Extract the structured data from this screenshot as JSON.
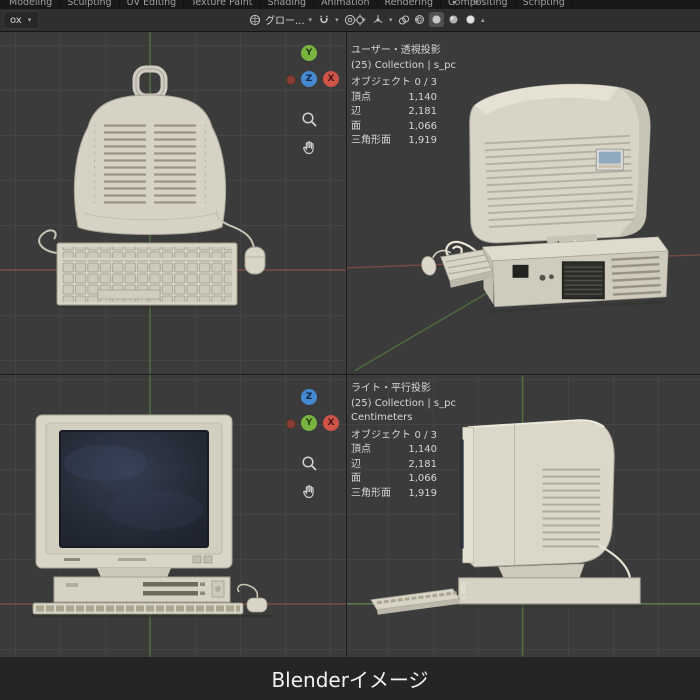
{
  "workspace_tabs": {
    "items": [
      "Modeling",
      "Sculpting",
      "UV Editing",
      "Texture Paint",
      "Shading",
      "Animation",
      "Rendering",
      "Compositing",
      "Scripting"
    ],
    "caret": "▾",
    "add_button": "+"
  },
  "toolbar": {
    "left_dropdown_value": "ox",
    "orientation_label": "グロー...",
    "caret": "▾",
    "caret_up": "▴"
  },
  "icons": {
    "transform_orientation": "globe-icon",
    "snap": "magnet-icon",
    "proportional_editing": "concentric-circles-icon",
    "cursor_tool": "3d-cursor-icon",
    "show_overlays": "overlay-spheres-icon",
    "shading_modes": [
      "wireframe-sphere",
      "solid-sphere",
      "material-sphere",
      "rendered-sphere"
    ],
    "viewport_zoom": "magnifier-icon",
    "viewport_pan": "hand-icon"
  },
  "viewports": {
    "top_left": {
      "gizmo": {
        "top_axis": "Y",
        "center_axis": "Z",
        "right_axis": "X"
      }
    },
    "top_right": {
      "view_label": "ユーザー・透視投影",
      "collection_path": "(25) Collection | s_pc",
      "stats": {
        "objects_label": "オブジェクト",
        "objects_value": "0 / 3",
        "rows": [
          {
            "label": "頂点",
            "value": "1,140"
          },
          {
            "label": "辺",
            "value": "2,181"
          },
          {
            "label": "面",
            "value": "1,066"
          },
          {
            "label": "三角形面",
            "value": "1,919"
          }
        ]
      }
    },
    "bottom_left": {
      "gizmo": {
        "top_axis": "Z",
        "center_axis": "Y",
        "right_axis": "X"
      }
    },
    "bottom_right": {
      "view_label": "ライト・平行投影",
      "collection_path": "(25) Collection | s_pc",
      "units": "Centimeters",
      "stats": {
        "objects_label": "オブジェクト",
        "objects_value": "0 / 3",
        "rows": [
          {
            "label": "頂点",
            "value": "1,140"
          },
          {
            "label": "辺",
            "value": "2,181"
          },
          {
            "label": "面",
            "value": "1,066"
          },
          {
            "label": "三角形面",
            "value": "1,919"
          }
        ]
      }
    }
  },
  "caption": "Blenderイメージ",
  "colors": {
    "axis_x": "#7e4a45",
    "axis_y": "#50713f",
    "axis_z": "#46678c",
    "gizmo_x": "#d05348",
    "gizmo_y": "#79b43e",
    "gizmo_z": "#4589d0",
    "model_beige": "#d8d4c5",
    "screen_navy": "#262c38"
  }
}
